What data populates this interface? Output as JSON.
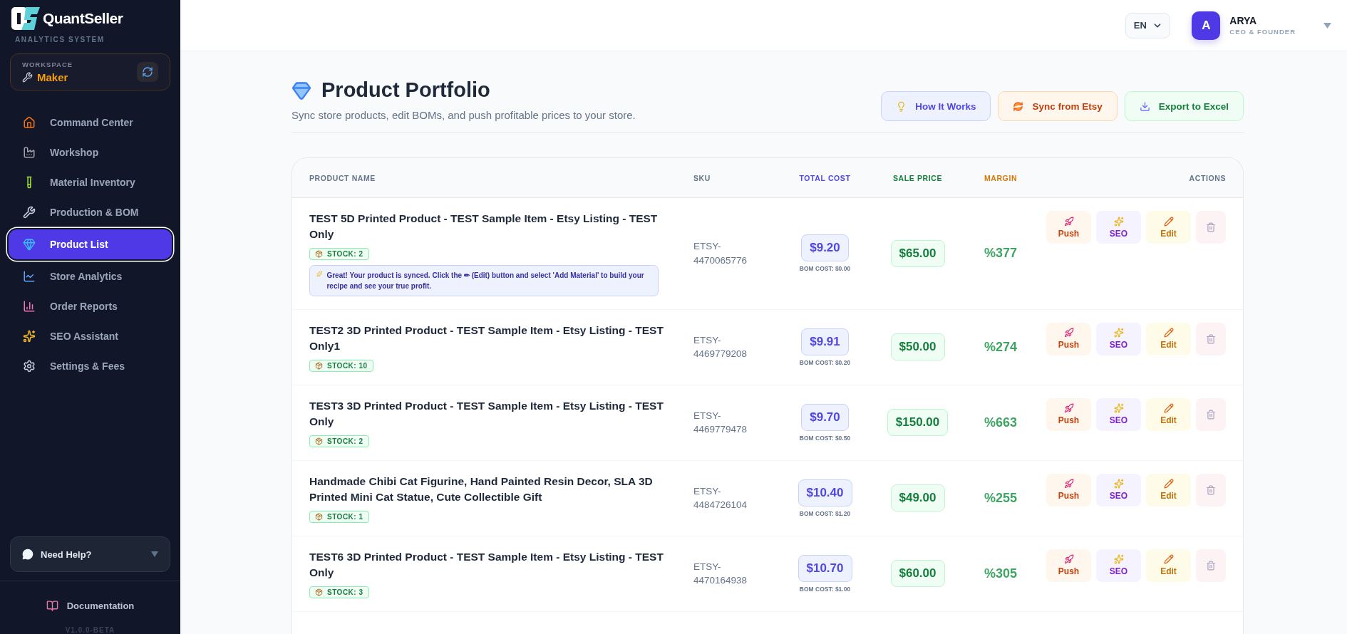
{
  "sidebar": {
    "brand": {
      "name": "QuantSeller",
      "tagline": "ANALYTICS SYSTEM"
    },
    "workspace": {
      "label": "WORKSPACE",
      "value": "Maker"
    },
    "nav": [
      {
        "label": "Command Center",
        "selected": false
      },
      {
        "label": "Workshop",
        "selected": false
      },
      {
        "label": "Material Inventory",
        "selected": false
      },
      {
        "label": "Production & BOM",
        "selected": false
      },
      {
        "label": "Product List",
        "selected": true
      },
      {
        "label": "Store Analytics",
        "selected": false
      },
      {
        "label": "Order Reports",
        "selected": false
      },
      {
        "label": "SEO Assistant",
        "selected": false
      },
      {
        "label": "Settings & Fees",
        "selected": false
      }
    ],
    "help": {
      "label": "Need Help?"
    },
    "docs": "Documentation",
    "version": "V1.0.0-BETA"
  },
  "header": {
    "language": "EN",
    "user": {
      "initial": "A",
      "name": "ARYA",
      "role": "CEO & FOUNDER"
    }
  },
  "page": {
    "title": "Product Portfolio",
    "subtitle": "Sync store products, edit BOMs, and push profitable prices to your store.",
    "actions": [
      {
        "label": "How It Works",
        "kind": "info"
      },
      {
        "label": "Sync from Etsy",
        "kind": "sync"
      },
      {
        "label": "Export to Excel",
        "kind": "export"
      }
    ]
  },
  "table": {
    "columns": [
      {
        "label": "PRODUCT NAME",
        "color": "#64748b"
      },
      {
        "label": "SKU",
        "color": "#64748b"
      },
      {
        "label": "TOTAL COST",
        "color": "#4f46e5"
      },
      {
        "label": "SALE PRICE",
        "color": "#15803d"
      },
      {
        "label": "MARGIN",
        "color": "#d97706"
      },
      {
        "label": "ACTIONS",
        "color": "#64748b"
      }
    ],
    "rows": [
      {
        "name": "TEST 5D Printed Product - TEST Sample Item - Etsy Listing - TEST Only",
        "stock": "STOCK: 2",
        "hint": "Great! Your product is synced. Click the ✏ (Edit) button and select 'Add Material' to build your recipe and see your true profit.",
        "sku": "ETSY-4470065776",
        "total_cost": "$9.20",
        "bom_cost": "BOM COST: $0.00",
        "sale_price": "$65.00",
        "margin": "%377",
        "actions": [
          {
            "label": "Push",
            "kind": "push"
          },
          {
            "label": "SEO",
            "kind": "seo"
          },
          {
            "label": "Edit",
            "kind": "edit"
          },
          {
            "kind": "delete"
          }
        ]
      },
      {
        "name": "TEST2 3D Printed Product - TEST Sample Item - Etsy Listing - TEST Only1",
        "stock": "STOCK: 10",
        "sku": "ETSY-4469779208",
        "total_cost": "$9.91",
        "bom_cost": "BOM COST: $0.20",
        "sale_price": "$50.00",
        "margin": "%274",
        "actions": [
          {
            "label": "Push",
            "kind": "push"
          },
          {
            "label": "SEO",
            "kind": "seo"
          },
          {
            "label": "Edit",
            "kind": "edit"
          },
          {
            "kind": "delete"
          }
        ]
      },
      {
        "name": "TEST3 3D Printed Product - TEST Sample Item - Etsy Listing - TEST Only",
        "stock": "STOCK: 2",
        "sku": "ETSY-4469779478",
        "total_cost": "$9.70",
        "bom_cost": "BOM COST: $0.50",
        "sale_price": "$150.00",
        "margin": "%663",
        "actions": [
          {
            "label": "Push",
            "kind": "push"
          },
          {
            "label": "SEO",
            "kind": "seo"
          },
          {
            "label": "Edit",
            "kind": "edit"
          },
          {
            "kind": "delete"
          }
        ]
      },
      {
        "name": "Handmade Chibi Cat Figurine, Hand Painted Resin Decor, SLA 3D Printed Mini Cat Statue, Cute Collectible Gift",
        "stock": "STOCK: 1",
        "sku": "ETSY-4484726104",
        "total_cost": "$10.40",
        "bom_cost": "BOM COST: $1.20",
        "sale_price": "$49.00",
        "margin": "%255",
        "actions": [
          {
            "label": "Push",
            "kind": "push"
          },
          {
            "label": "SEO",
            "kind": "seo"
          },
          {
            "label": "Edit",
            "kind": "edit"
          },
          {
            "kind": "delete"
          }
        ]
      },
      {
        "name": "TEST6 3D Printed Product - TEST Sample Item - Etsy Listing - TEST Only",
        "stock": "STOCK: 3",
        "sku": "ETSY-4470164938",
        "total_cost": "$10.70",
        "bom_cost": "BOM COST: $1.00",
        "sale_price": "$60.00",
        "margin": "%305",
        "actions": [
          {
            "label": "Push",
            "kind": "push"
          },
          {
            "label": "SEO",
            "kind": "seo"
          },
          {
            "label": "Edit",
            "kind": "edit"
          },
          {
            "kind": "delete"
          }
        ]
      }
    ]
  }
}
